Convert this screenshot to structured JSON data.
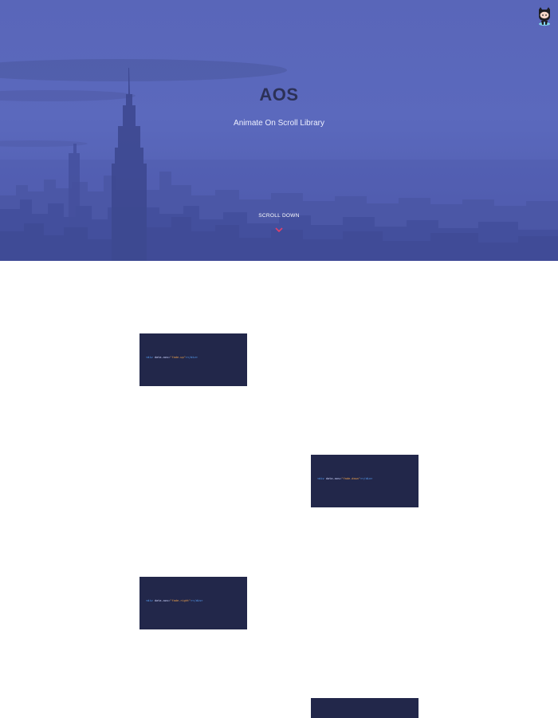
{
  "hero": {
    "title": "AOS",
    "subtitle": "Animate On Scroll Library",
    "scroll_label": "SCROLL DOWN",
    "background_color": "#5b69bd",
    "chevron_color": "#e2406b"
  },
  "header": {
    "icon": "github-octocat-icon"
  },
  "examples": [
    {
      "open_tag": "<div",
      "attr": " data-aos=",
      "value": "\"fade-up\"",
      "close_tag": "></div>"
    },
    {
      "open_tag": "<div",
      "attr": " data-aos=",
      "value": "\"fade-down\"",
      "close_tag": "></div>"
    },
    {
      "open_tag": "<div",
      "attr": " data-aos=",
      "value": "\"fade-right\"",
      "close_tag": "></div>"
    },
    {
      "open_tag": "",
      "attr": "",
      "value": "",
      "close_tag": ""
    }
  ],
  "colors": {
    "code_bg": "#22274a",
    "tag": "#5aa6ff",
    "string": "#f2a44b"
  }
}
